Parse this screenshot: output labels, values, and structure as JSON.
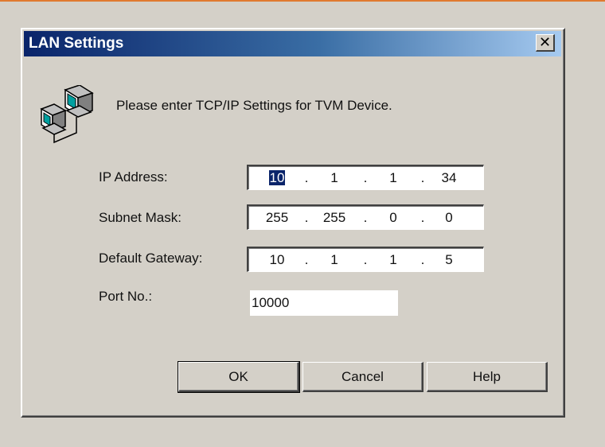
{
  "dialog": {
    "title": "LAN Settings",
    "close_glyph": "✕",
    "icon": "network-computers-icon",
    "prompt": "Please enter TCP/IP Settings for TVM Device."
  },
  "fields": {
    "ip": {
      "label": "IP Address:",
      "octets": [
        "10",
        "1",
        "1",
        "34"
      ]
    },
    "subnet": {
      "label": "Subnet Mask:",
      "octets": [
        "255",
        "255",
        "0",
        "0"
      ]
    },
    "gateway": {
      "label": "Default Gateway:",
      "octets": [
        "10",
        "1",
        "1",
        "5"
      ]
    },
    "port": {
      "label": "Port No.:",
      "value": "10000"
    }
  },
  "separator": ".",
  "buttons": {
    "ok": "OK",
    "cancel": "Cancel",
    "help": "Help"
  },
  "colors": {
    "title_gradient_start": "#0a246a",
    "title_gradient_end": "#a6caf0",
    "selection": "#0a246a",
    "dialog_face": "#d4d0c8"
  }
}
